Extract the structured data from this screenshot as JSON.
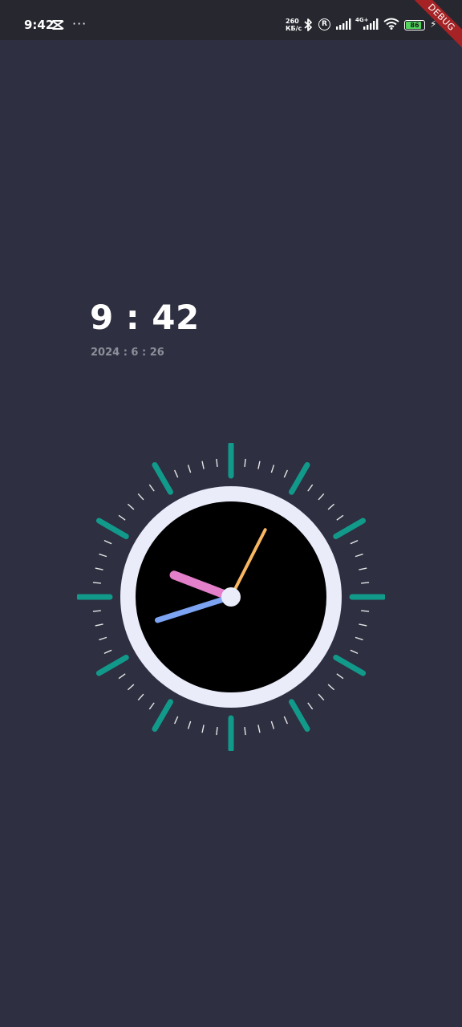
{
  "status_bar": {
    "time": "9:42",
    "app_icon": "capcut-icon",
    "more_icon": "···",
    "net_speed_value": "260",
    "net_speed_unit": "КБ/с",
    "bluetooth_icon": "bluetooth-icon",
    "roaming_icon": "R",
    "network_label": "4G+",
    "wifi_icon": "wifi-icon",
    "battery_level": "86",
    "battery_fraction": 0.86,
    "charging_icon": "⚡"
  },
  "debug_banner": "DEBUG",
  "digital_clock": {
    "time": "9 : 42",
    "date": "2024 : 6 : 26"
  },
  "analog_clock": {
    "hour": 9,
    "minute": 42,
    "second": 4.5,
    "colors": {
      "background": "#2e2f41",
      "dial_ring": "#eaecfa",
      "dial_face": "#000000",
      "major_ticks": "#119a8a",
      "minor_ticks": "#e6e6e6",
      "hour_hand": "#e47fc9",
      "minute_hand": "#7ca4f3",
      "second_hand": "#f8b661",
      "center_cap": "#eaecfa"
    }
  }
}
